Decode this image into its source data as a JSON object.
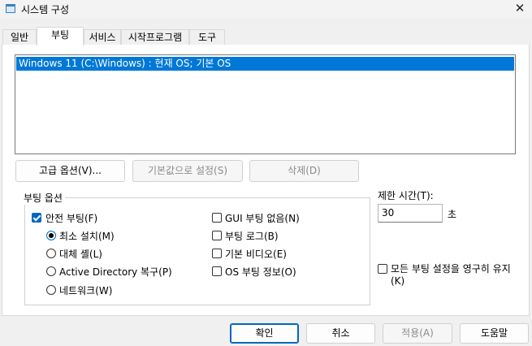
{
  "window": {
    "title": "시스템 구성",
    "close_glyph": "✕"
  },
  "tabs": [
    {
      "label": "일반"
    },
    {
      "label": "부팅"
    },
    {
      "label": "서비스"
    },
    {
      "label": "시작프로그램"
    },
    {
      "label": "도구"
    }
  ],
  "active_tab": "부팅",
  "os_list": [
    {
      "label": "Windows 11 (C:\\Windows) : 현재 OS; 기본 OS",
      "selected": true
    }
  ],
  "list_buttons": {
    "advanced": "고급 옵션(V)...",
    "set_default": "기본값으로 설정(S)",
    "delete": "삭제(D)"
  },
  "boot_options": {
    "title": "부팅 옵션",
    "safe_boot": {
      "label": "안전 부팅(F)",
      "checked": true
    },
    "radios": [
      {
        "label": "최소 설치(M)",
        "checked": true
      },
      {
        "label": "대체 셸(L)",
        "checked": false
      },
      {
        "label": "Active Directory 복구(P)",
        "checked": false
      },
      {
        "label": "네트워크(W)",
        "checked": false
      }
    ],
    "checks": [
      {
        "label": "GUI 부팅 없음(N)",
        "checked": false
      },
      {
        "label": "부팅 로그(B)",
        "checked": false
      },
      {
        "label": "기본 비디오(E)",
        "checked": false
      },
      {
        "label": "OS 부팅 정보(O)",
        "checked": false
      }
    ]
  },
  "timeout": {
    "label": "제한 시간(T):",
    "value": "30",
    "unit": "초"
  },
  "permanent": {
    "line1": "모든 부팅 설정을 영구히 유지",
    "line2": "(K)",
    "checked": false
  },
  "dialog_buttons": {
    "ok": "확인",
    "cancel": "취소",
    "apply": "적용(A)",
    "help": "도움말"
  },
  "colors": {
    "accent": "#0078d7",
    "selection": "#0078d7"
  }
}
